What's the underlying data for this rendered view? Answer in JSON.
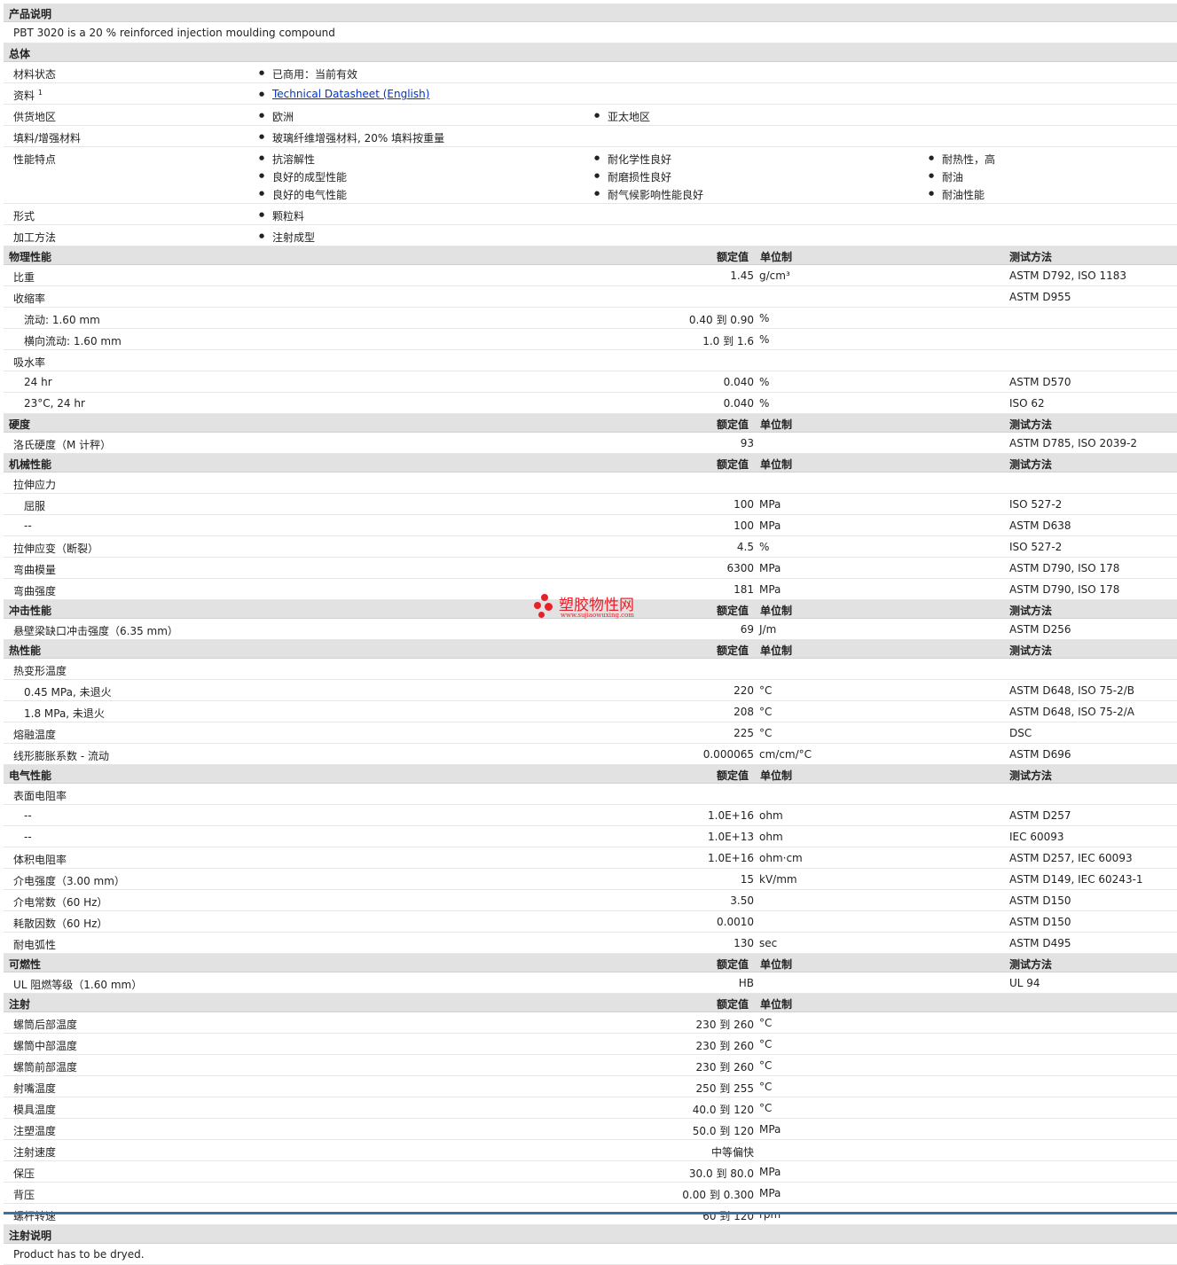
{
  "desc": {
    "header": "产品说明",
    "text": "PBT 3020 is a 20 % reinforced injection moulding compound"
  },
  "general": {
    "header": "总体",
    "status_label": "材料状态",
    "status": "已商用：当前有效",
    "info_label": "资料",
    "info_sup": "1",
    "info_link": "Technical Datasheet (English)",
    "region_label": "供货地区",
    "regions": [
      "欧洲",
      "亚太地区"
    ],
    "filler_label": "填料/增强材料",
    "filler": "玻璃纤维增强材料, 20% 填料按重量",
    "features_label": "性能特点",
    "features": [
      "抗溶解性",
      "耐化学性良好",
      "耐热性，高",
      "良好的成型性能",
      "耐磨损性良好",
      "耐油",
      "良好的电气性能",
      "耐气候影响性能良好",
      "耐油性能"
    ],
    "form_label": "形式",
    "form": "颗粒料",
    "process_label": "加工方法",
    "process": "注射成型"
  },
  "col": {
    "value": "额定值",
    "unit": "单位制",
    "method": "测试方法"
  },
  "physical": {
    "header": "物理性能",
    "rows": [
      {
        "label": "比重",
        "value": "1.45",
        "unit": "g/cm³",
        "method": "ASTM D792, ISO 1183"
      },
      {
        "label": "收缩率",
        "value": "",
        "unit": "",
        "method": "ASTM D955"
      },
      {
        "label": "流动: 1.60 mm",
        "value": "0.40 到  0.90",
        "unit": "%",
        "method": ""
      },
      {
        "label": "横向流动: 1.60 mm",
        "value": "1.0 到  1.6",
        "unit": "%",
        "method": ""
      },
      {
        "label": "吸水率",
        "value": "",
        "unit": "",
        "method": ""
      },
      {
        "label": "24 hr",
        "value": "0.040",
        "unit": "%",
        "method": "ASTM D570"
      },
      {
        "label": "23°C, 24 hr",
        "value": "0.040",
        "unit": "%",
        "method": "ISO 62"
      }
    ]
  },
  "hardness": {
    "header": "硬度",
    "rows": [
      {
        "label": "洛氏硬度（M 计秤）",
        "value": "93",
        "unit": "",
        "method": "ASTM D785, ISO 2039-2"
      }
    ]
  },
  "mechanical": {
    "header": "机械性能",
    "rows": [
      {
        "label": "拉伸应力",
        "value": "",
        "unit": "",
        "method": ""
      },
      {
        "label": "屈服",
        "value": "100",
        "unit": "MPa",
        "method": "ISO 527-2"
      },
      {
        "label": "--",
        "value": "100",
        "unit": "MPa",
        "method": "ASTM D638"
      },
      {
        "label": "拉伸应变（断裂）",
        "value": "4.5",
        "unit": "%",
        "method": "ISO 527-2"
      },
      {
        "label": "弯曲模量",
        "value": "6300",
        "unit": "MPa",
        "method": "ASTM D790, ISO 178"
      },
      {
        "label": "弯曲强度",
        "value": "181",
        "unit": "MPa",
        "method": "ASTM D790, ISO 178"
      }
    ]
  },
  "impact": {
    "header": "冲击性能",
    "rows": [
      {
        "label": "悬壁梁缺口冲击强度（6.35 mm）",
        "value": "69",
        "unit": "J/m",
        "method": "ASTM D256"
      }
    ]
  },
  "thermal": {
    "header": "热性能",
    "rows": [
      {
        "label": "热变形温度",
        "value": "",
        "unit": "",
        "method": ""
      },
      {
        "label": "0.45 MPa, 未退火",
        "value": "220",
        "unit": "°C",
        "method": "ASTM D648, ISO 75-2/B"
      },
      {
        "label": "1.8 MPa, 未退火",
        "value": "208",
        "unit": "°C",
        "method": "ASTM D648, ISO 75-2/A"
      },
      {
        "label": "熔融温度",
        "value": "225",
        "unit": "°C",
        "method": "DSC"
      },
      {
        "label": "线形膨胀系数 - 流动",
        "value": "0.000065",
        "unit": "cm/cm/°C",
        "method": "ASTM D696"
      }
    ]
  },
  "electrical": {
    "header": "电气性能",
    "rows": [
      {
        "label": "表面电阻率",
        "value": "",
        "unit": "",
        "method": ""
      },
      {
        "label": "--",
        "value": "1.0E+16",
        "unit": "ohm",
        "method": "ASTM D257"
      },
      {
        "label": "--",
        "value": "1.0E+13",
        "unit": "ohm",
        "method": "IEC 60093"
      },
      {
        "label": "体积电阻率",
        "value": "1.0E+16",
        "unit": "ohm·cm",
        "method": "ASTM D257, IEC 60093"
      },
      {
        "label": "介电强度（3.00 mm）",
        "value": "15",
        "unit": "kV/mm",
        "method": "ASTM D149, IEC 60243-1"
      },
      {
        "label": "介电常数（60 Hz）",
        "value": "3.50",
        "unit": "",
        "method": "ASTM D150"
      },
      {
        "label": "耗散因数（60 Hz）",
        "value": "0.0010",
        "unit": "",
        "method": "ASTM D150"
      },
      {
        "label": "耐电弧性",
        "value": "130",
        "unit": "sec",
        "method": "ASTM D495"
      }
    ]
  },
  "flammability": {
    "header": "可燃性",
    "rows": [
      {
        "label": "UL 阻燃等级（1.60 mm）",
        "value": "HB",
        "unit": "",
        "method": "UL 94"
      }
    ]
  },
  "injection": {
    "header": "注射",
    "rows": [
      {
        "label": "螺筒后部温度",
        "value": "230 到  260",
        "unit": "°C"
      },
      {
        "label": "螺筒中部温度",
        "value": "230 到  260",
        "unit": "°C"
      },
      {
        "label": "螺筒前部温度",
        "value": "230 到  260",
        "unit": "°C"
      },
      {
        "label": "射嘴温度",
        "value": "250 到  255",
        "unit": "°C"
      },
      {
        "label": "模具温度",
        "value": "40.0 到  120",
        "unit": "°C"
      },
      {
        "label": "注塑温度",
        "value": "50.0 到  120",
        "unit": "MPa"
      },
      {
        "label": "注射速度",
        "value": "中等偏快",
        "unit": ""
      },
      {
        "label": "保压",
        "value": "30.0 到  80.0",
        "unit": "MPa"
      },
      {
        "label": "背压",
        "value": "0.00 到  0.300",
        "unit": "MPa"
      },
      {
        "label": "螺杆转速",
        "value": "60 到  120",
        "unit": "rpm"
      }
    ]
  },
  "inj_notes": {
    "header": "注射说明",
    "text": "Product has to be dryed."
  },
  "watermark": {
    "cn": "塑胶物性网",
    "url": "www.sujiaowuxing.com"
  }
}
